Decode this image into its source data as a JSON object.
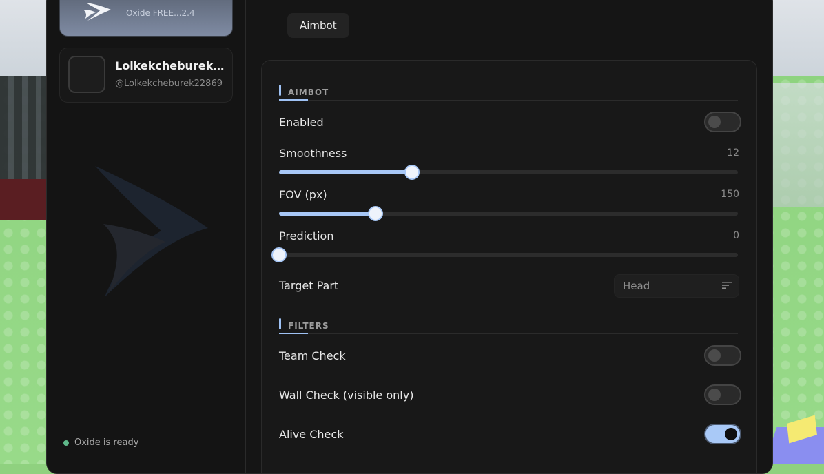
{
  "app": {
    "version_label": "Oxide FREE...2.4"
  },
  "user": {
    "name": "Lolkekcheburek2...",
    "handle": "@Lolkekcheburek22869"
  },
  "status": {
    "text": "Oxide is ready"
  },
  "tabs": [
    {
      "label": "Aimbot"
    }
  ],
  "sections": {
    "aimbot": {
      "title": "AIMBOT"
    },
    "filters": {
      "title": "FILTERS"
    }
  },
  "controls": {
    "enabled": {
      "label": "Enabled",
      "on": false
    },
    "smoothness": {
      "label": "Smoothness",
      "value": "12",
      "fill_fraction": 0.29
    },
    "fov": {
      "label": "FOV (px)",
      "value": "150",
      "fill_fraction": 0.21
    },
    "prediction": {
      "label": "Prediction",
      "value": "0",
      "fill_fraction": 0.0
    },
    "target_part": {
      "label": "Target Part",
      "value": "Head"
    },
    "team_check": {
      "label": "Team Check",
      "on": false
    },
    "wall_check": {
      "label": "Wall Check (visible only)",
      "on": false
    },
    "alive_check": {
      "label": "Alive Check",
      "on": true
    }
  },
  "colors": {
    "accent": "#a7c7f6",
    "window_bg": "#151515",
    "status_dot": "#5fb88a"
  }
}
